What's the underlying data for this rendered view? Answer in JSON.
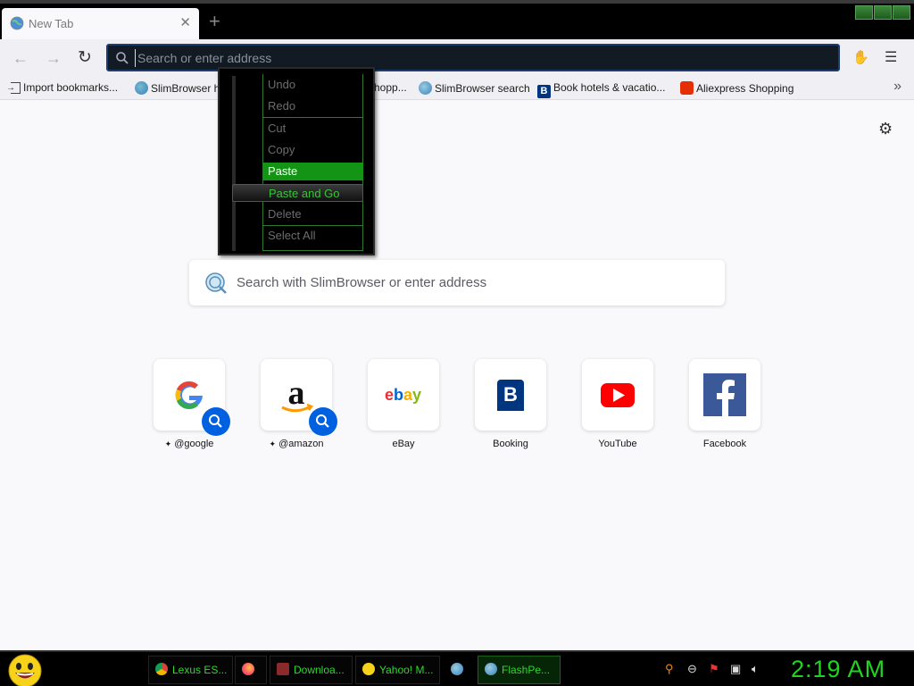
{
  "tab": {
    "title": "New Tab"
  },
  "urlbar": {
    "placeholder": "Search or enter address"
  },
  "bookmarks": [
    {
      "label": "Import bookmarks..."
    },
    {
      "label": "SlimBrowser h"
    },
    {
      "label": "hopp..."
    },
    {
      "label": "SlimBrowser search"
    },
    {
      "label": "Book hotels & vacatio..."
    },
    {
      "label": "Aliexpress Shopping"
    }
  ],
  "context_menu": {
    "items": [
      {
        "label": "Undo",
        "state": "disabled"
      },
      {
        "label": "Redo",
        "state": "disabled"
      },
      {
        "label": "Cut",
        "state": "disabled"
      },
      {
        "label": "Copy",
        "state": "disabled"
      },
      {
        "label": "Paste",
        "state": "highlighted"
      },
      {
        "label": "Paste and Go",
        "state": "hovered"
      },
      {
        "label": "Delete",
        "state": "disabled"
      },
      {
        "label": "Select All",
        "state": "disabled"
      }
    ]
  },
  "search": {
    "placeholder": "Search with SlimBrowser or enter address"
  },
  "top_sites": [
    {
      "label": "@google",
      "icon": "google-icon",
      "pinned": true
    },
    {
      "label": "@amazon",
      "icon": "amazon-icon",
      "pinned": true
    },
    {
      "label": "eBay",
      "icon": "ebay-icon"
    },
    {
      "label": "Booking",
      "icon": "booking-icon"
    },
    {
      "label": "YouTube",
      "icon": "youtube-icon"
    },
    {
      "label": "Facebook",
      "icon": "facebook-icon"
    }
  ],
  "taskbar": {
    "tasks": [
      {
        "label": "Lexus ES..."
      },
      {
        "label": ""
      },
      {
        "label": "Downloa..."
      },
      {
        "label": "Yahoo! M..."
      },
      {
        "label": ""
      },
      {
        "label": "FlashPe..."
      }
    ],
    "clock": "2:19 AM"
  }
}
